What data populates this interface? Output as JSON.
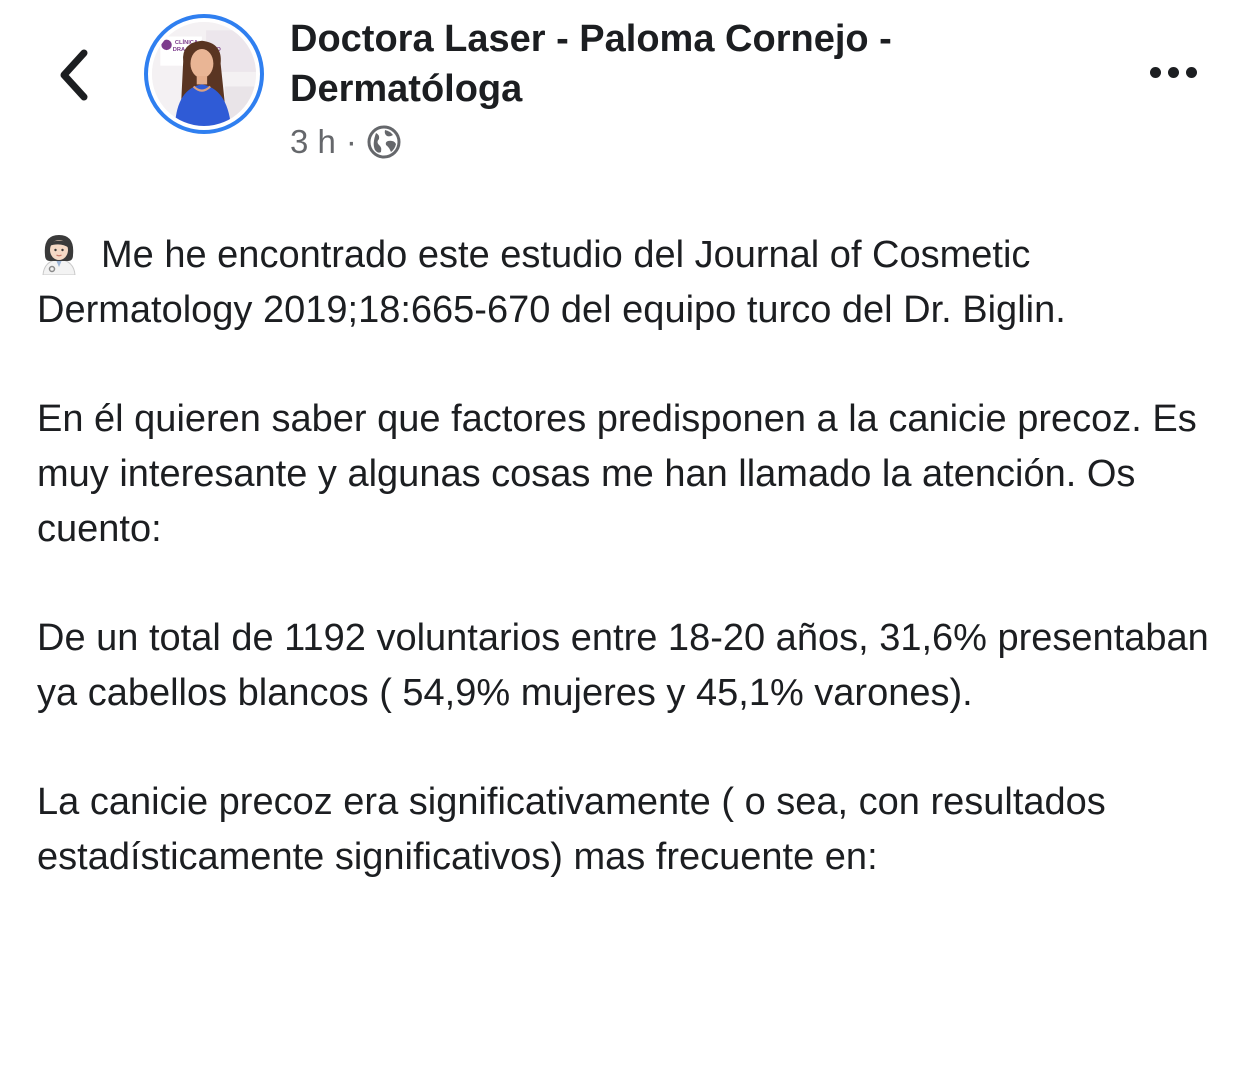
{
  "header": {
    "back_icon": "chevron-left-icon",
    "page_name": "Doctora Laser - Paloma Cornejo - Dermatóloga",
    "avatar_sign_lines": [
      "CLÍNICA",
      "DRA PALOMA CO"
    ],
    "time": "3 h",
    "separator": "·",
    "privacy_icon": "globe-icon",
    "more_icon": "more-horizontal-icon",
    "ring_color": "#2f7ff0"
  },
  "post": {
    "leading_emoji": "woman-health-worker-emoji",
    "paragraphs": [
      "Me he encontrado este estudio del Journal of Cosmetic Dermatology 2019;18:665-670 del equipo turco del Dr. Biglin.",
      "En él quieren saber que factores predisponen a la canicie precoz. Es muy interesante y algunas cosas me han llamado la atención. Os cuento:",
      "De un total de 1192 voluntarios entre 18-20 años, 31,6% presentaban ya cabellos blancos ( 54,9% mujeres y 45,1% varones).",
      "La canicie precoz era significativamente ( o sea, con resultados estadísticamente significativos) mas frecuente en:"
    ]
  }
}
